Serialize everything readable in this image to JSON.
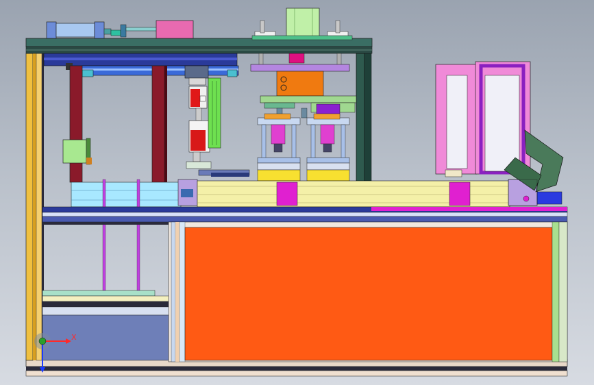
{
  "viewport": {
    "background_top": "#9aa3b0",
    "background_bottom": "#d7dbe2"
  },
  "triad": {
    "x_label": "X",
    "x_color": "#ff2a2a",
    "y_color": "#2a9a2a",
    "z_color": "#1a3aff"
  },
  "colors": {
    "frame_yellow": "#f0c040",
    "frame_dark_green": "#2e5a4e",
    "top_plate": "#2f5a52",
    "orange_panel": "#ff5a14",
    "pink_frame": "#f08ad8",
    "magenta": "#e020d0",
    "light_green": "#9ee07a",
    "purple_plate": "#b486e0",
    "dark_red": "#8a1a2a",
    "cyan_rail": "#a8e8ff",
    "conveyor_cream": "#f4f0a8",
    "blue_tank": "#6e7fb8"
  }
}
